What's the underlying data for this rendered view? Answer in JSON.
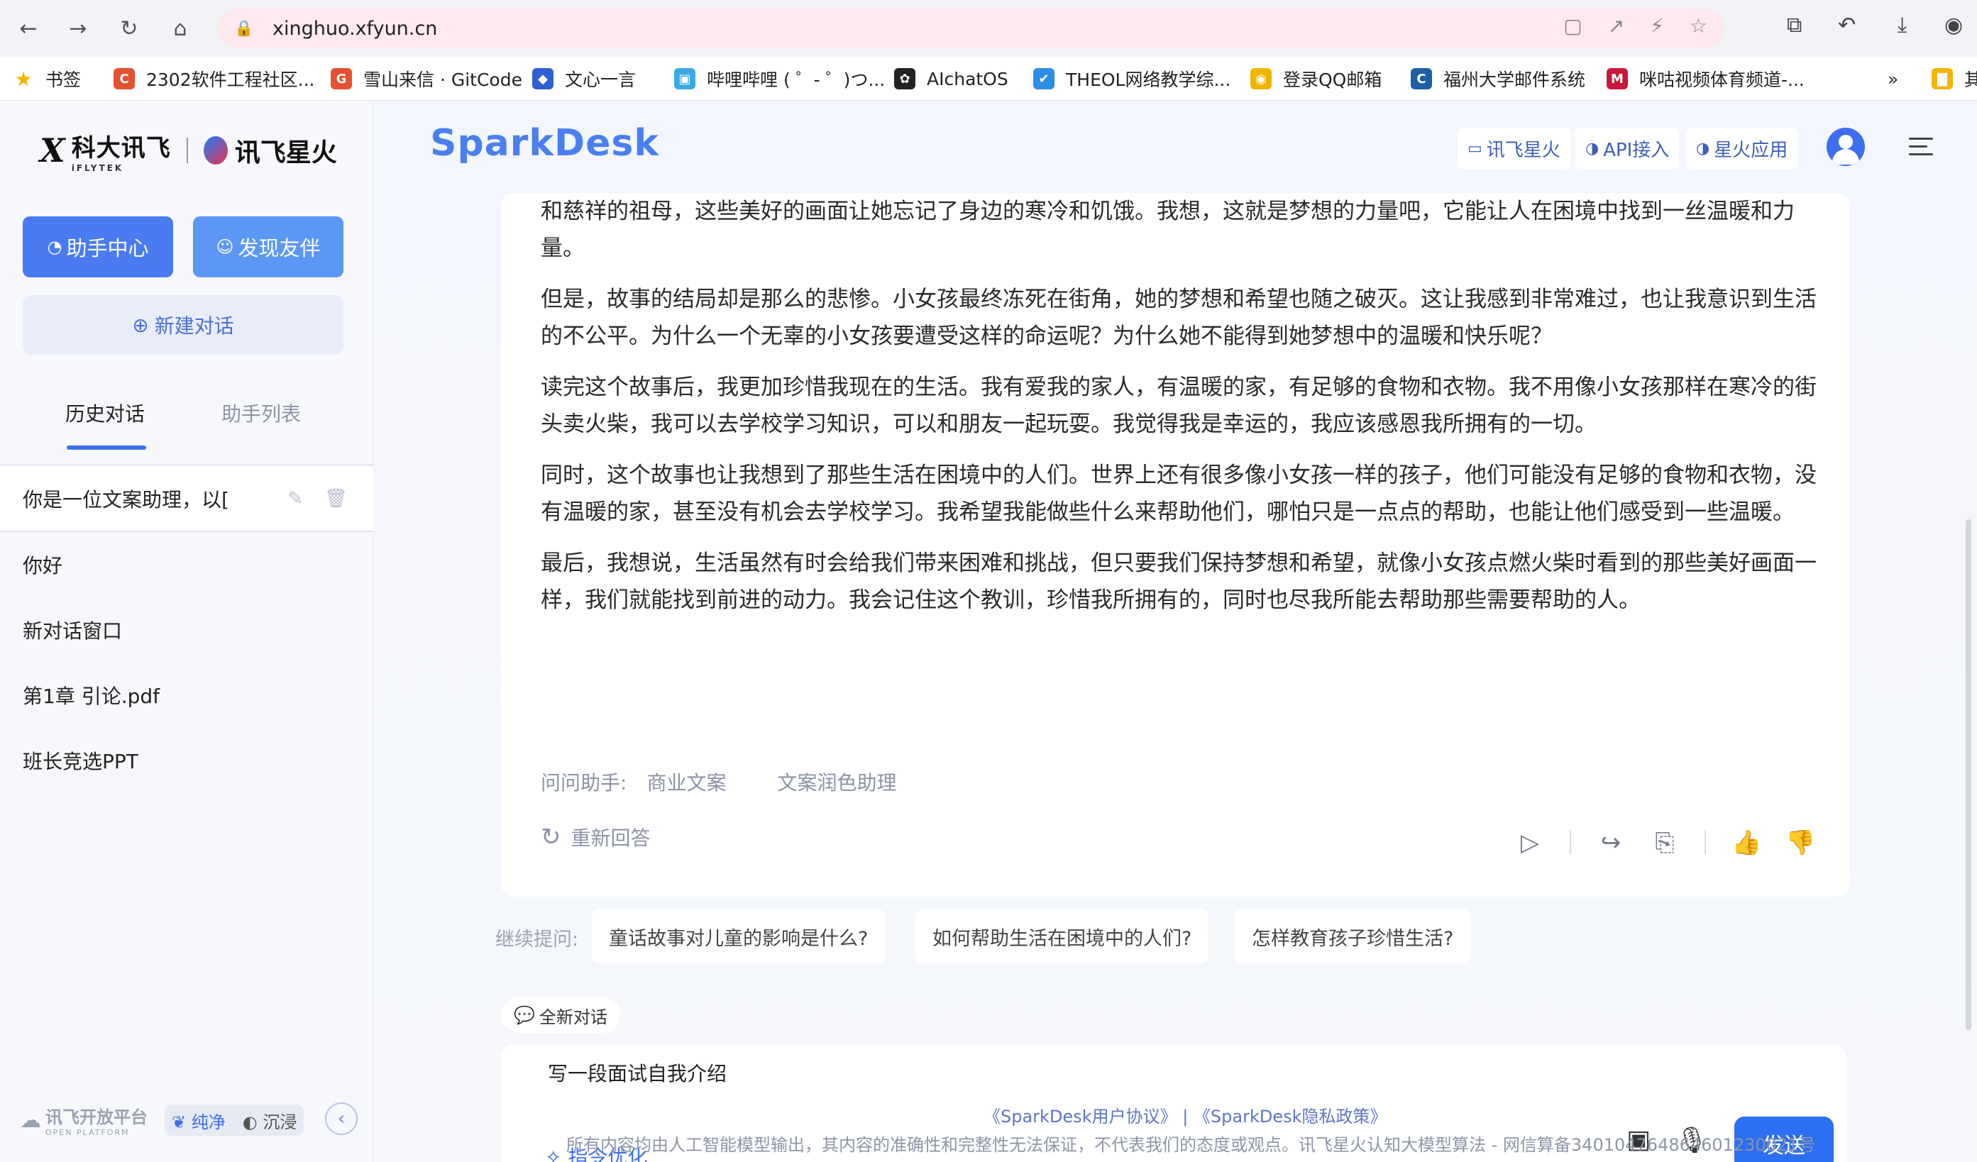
{
  "browser": {
    "url": "xinghuo.xfyun.cn",
    "bookmarks": [
      {
        "label": "书签",
        "color": "#f5b400",
        "glyph": "★"
      },
      {
        "label": "2302软件工程社区...",
        "color": "#e5502e",
        "glyph": "C"
      },
      {
        "label": "雪山来信 · GitCode",
        "color": "#e5502e",
        "glyph": "G"
      },
      {
        "label": "文心一言",
        "color": "#2f5fd0",
        "glyph": "◆"
      },
      {
        "label": "哔哩哔哩 ( ゜- ゜)つ...",
        "color": "#3aa9e8",
        "glyph": "▣"
      },
      {
        "label": "AIchatOS",
        "color": "#222222",
        "glyph": "✿"
      },
      {
        "label": "THEOL网络教学综...",
        "color": "#2d8ce8",
        "glyph": "✔"
      },
      {
        "label": "登录QQ邮箱",
        "color": "#f0b400",
        "glyph": "◉"
      },
      {
        "label": "福州大学邮件系统",
        "color": "#1f5fa8",
        "glyph": "C"
      },
      {
        "label": "咪咕视频体育频道-...",
        "color": "#c8183a",
        "glyph": "M"
      },
      {
        "label": "»",
        "color": "",
        "glyph": ""
      },
      {
        "label": "其",
        "color": "#f5b400",
        "glyph": "▇"
      }
    ]
  },
  "sidebar": {
    "brand_left": "科大讯飞",
    "brand_left_sub": "iFLYTEK",
    "brand_right": "讯飞星火",
    "assistant_center": "助手中心",
    "discover": "发现友伴",
    "new_chat": "新建对话",
    "tabs": [
      "历史对话",
      "助手列表"
    ],
    "history": [
      "你是一位文案助理，以[",
      "你好",
      "新对话窗口",
      "第1章 引论.pdf",
      "班长竞选PPT"
    ],
    "open_platform": "讯飞开放平台",
    "open_platform_sub": "OPEN PLATFORM",
    "mode_pure": "纯净",
    "mode_immersive": "沉浸"
  },
  "header": {
    "title": "SparkDesk",
    "links": [
      "讯飞星火",
      "API接入",
      "星火应用"
    ]
  },
  "answer": {
    "paragraphs": [
      "和慈祥的祖母，这些美好的画面让她忘记了身边的寒冷和饥饿。我想，这就是梦想的力量吧，它能让人在困境中找到一丝温暖和力量。",
      "但是，故事的结局却是那么的悲惨。小女孩最终冻死在街角，她的梦想和希望也随之破灭。这让我感到非常难过，也让我意识到生活的不公平。为什么一个无辜的小女孩要遭受这样的命运呢？为什么她不能得到她梦想中的温暖和快乐呢？",
      "读完这个故事后，我更加珍惜我现在的生活。我有爱我的家人，有温暖的家，有足够的食物和衣物。我不用像小女孩那样在寒冷的街头卖火柴，我可以去学校学习知识，可以和朋友一起玩耍。我觉得我是幸运的，我应该感恩我所拥有的一切。",
      "同时，这个故事也让我想到了那些生活在困境中的人们。世界上还有很多像小女孩一样的孩子，他们可能没有足够的食物和衣物，没有温暖的家，甚至没有机会去学校学习。我希望我能做些什么来帮助他们，哪怕只是一点点的帮助，也能让他们感受到一些温暖。",
      "最后，我想说，生活虽然有时会给我们带来困难和挑战，但只要我们保持梦想和希望，就像小女孩点燃火柴时看到的那些美好画面一样，我们就能找到前进的动力。我会记住这个教训，珍惜我所拥有的，同时也尽我所能去帮助那些需要帮助的人。"
    ],
    "ask_label": "问问助手:",
    "ask_options": [
      "商业文案",
      "文案润色助理"
    ],
    "regenerate": "重新回答"
  },
  "followups": {
    "label": "继续提问:",
    "items": [
      "童话故事对儿童的影响是什么?",
      "如何帮助生活在困境中的人们?",
      "怎样教育孩子珍惜生活?"
    ]
  },
  "composer": {
    "new_chat_tag": "全新对话",
    "input_value": "写一段面试自我介绍",
    "optimize": "指令优化",
    "send": "发送"
  },
  "footer": {
    "links": "《SparkDesk用户协议》 | 《SparkDesk隐私政策》",
    "note": "所有内容均由人工智能模型输出，其内容的准确性和完整性无法保证，不代表我们的态度或观点。讯飞星火认知大模型算法 - 网信算备340104764864601230021号"
  },
  "colors": {
    "accent": "#3d6ff0",
    "send": "#2d6ff2",
    "brand_title": "#4a7ff0"
  }
}
